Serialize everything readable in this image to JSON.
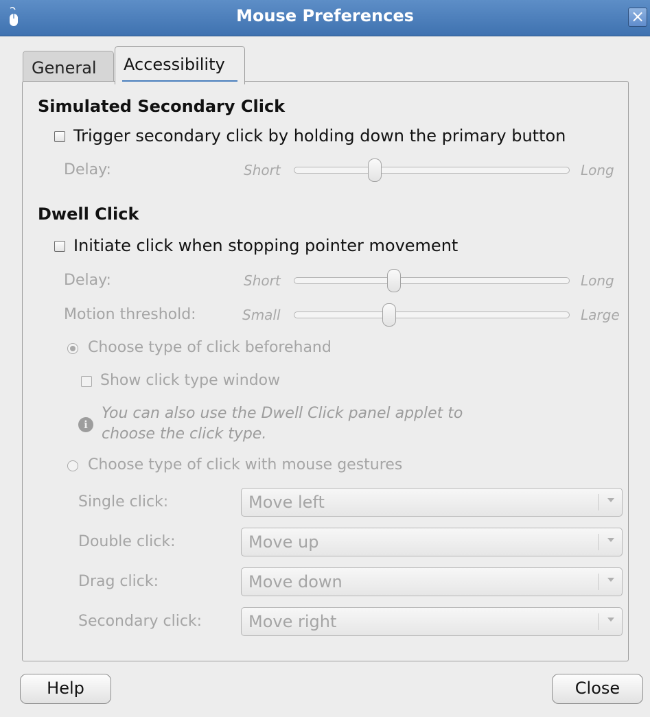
{
  "window": {
    "title": "Mouse Preferences"
  },
  "tabs": [
    {
      "label": "General",
      "selected": false
    },
    {
      "label": "Accessibility",
      "selected": true
    }
  ],
  "secondary_click": {
    "heading": "Simulated Secondary Click",
    "checkbox_label": "Trigger secondary click by holding down the primary button",
    "checked": false,
    "delay": {
      "label": "Delay:",
      "min_label": "Short",
      "max_label": "Long",
      "value_fraction": 0.29
    }
  },
  "dwell_click": {
    "heading": "Dwell Click",
    "checkbox_label": "Initiate click when stopping pointer movement",
    "checked": false,
    "delay": {
      "label": "Delay:",
      "min_label": "Short",
      "max_label": "Long",
      "value_fraction": 0.36
    },
    "motion_threshold": {
      "label": "Motion threshold:",
      "min_label": "Small",
      "max_label": "Large",
      "value_fraction": 0.33
    },
    "radio_beforehand": {
      "label": "Choose type of click beforehand",
      "checked": true
    },
    "show_window": {
      "label": "Show click type window",
      "checked": false
    },
    "info_text": "You can also use the Dwell Click panel applet to choose the click type.",
    "radio_gestures": {
      "label": "Choose type of click with mouse gestures",
      "checked": false
    },
    "gestures": [
      {
        "label": "Single click:",
        "value": "Move left"
      },
      {
        "label": "Double click:",
        "value": "Move up"
      },
      {
        "label": "Drag click:",
        "value": "Move down"
      },
      {
        "label": "Secondary click:",
        "value": "Move right"
      }
    ]
  },
  "buttons": {
    "help": "Help",
    "close": "Close"
  },
  "colors": {
    "titlebar": "#4a7fbd",
    "disabled_text": "#a5a5a5",
    "background": "#ededed"
  }
}
